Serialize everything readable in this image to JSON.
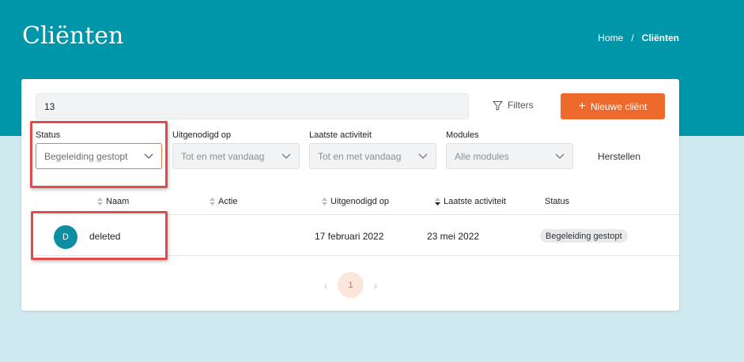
{
  "header": {
    "title": "Cliënten",
    "breadcrumb": {
      "home": "Home",
      "separator": "/",
      "current": "Cliënten"
    }
  },
  "toolbar": {
    "search_value": "13",
    "filters_label": "Filters",
    "new_client_label": "Nieuwe cliënt"
  },
  "filters": {
    "status": {
      "label": "Status",
      "value": "Begeleiding gestopt"
    },
    "invited": {
      "label": "Uitgenodigd op",
      "value": "Tot en met vandaag"
    },
    "last_activity": {
      "label": "Laatste activiteit",
      "value": "Tot en met vandaag"
    },
    "modules": {
      "label": "Modules",
      "value": "Alle modules"
    },
    "reset_label": "Herstellen"
  },
  "table": {
    "columns": {
      "name": "Naam",
      "action": "Actie",
      "invited": "Uitgenodigd op",
      "last_activity": "Laatste activiteit",
      "status": "Status"
    },
    "rows": [
      {
        "avatar_initial": "D",
        "name": "deleted",
        "action": "",
        "invited": "17 februari 2022",
        "last_activity": "23 mei 2022",
        "status": "Begeleiding gestopt"
      }
    ]
  },
  "pagination": {
    "prev": "‹",
    "current_page": "1",
    "next": "›"
  },
  "colors": {
    "brand_teal": "#0096a9",
    "accent_orange": "#ee6a2c",
    "highlight_red": "#e24b4b",
    "avatar": "#0e8ea1"
  }
}
